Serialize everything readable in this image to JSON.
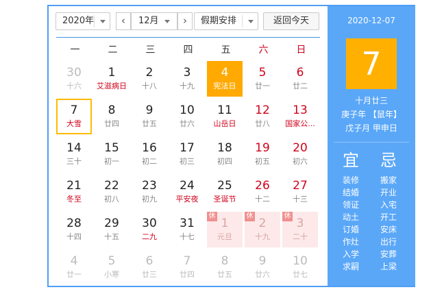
{
  "toolbar": {
    "year": "2020年",
    "month": "12月",
    "holiday": "假期安排",
    "today_button": "返回今天",
    "prev": "‹",
    "next": "›"
  },
  "weekdays": [
    "一",
    "二",
    "三",
    "四",
    "五",
    "六",
    "日"
  ],
  "colors": {
    "accent": "#4e9ef5",
    "selected": "#ffa901",
    "side": "#5aa7f8",
    "red": "#d0021b"
  },
  "weeks": [
    [
      {
        "d": "30",
        "l": "十六",
        "t": "other"
      },
      {
        "d": "1",
        "l": "艾滋病日",
        "fest": true
      },
      {
        "d": "2",
        "l": "十八"
      },
      {
        "d": "3",
        "l": "十九"
      },
      {
        "d": "4",
        "l": "宪法日",
        "t": "selected"
      },
      {
        "d": "5",
        "l": "廿一",
        "we": true
      },
      {
        "d": "6",
        "l": "廿二",
        "we": true
      }
    ],
    [
      {
        "d": "7",
        "l": "大雪",
        "t": "today",
        "fest": true
      },
      {
        "d": "8",
        "l": "廿四"
      },
      {
        "d": "9",
        "l": "廿五"
      },
      {
        "d": "10",
        "l": "廿六"
      },
      {
        "d": "11",
        "l": "山岳日",
        "fest": true
      },
      {
        "d": "12",
        "l": "廿八",
        "we": true
      },
      {
        "d": "13",
        "l": "国家公...",
        "we": true,
        "fest": true
      }
    ],
    [
      {
        "d": "14",
        "l": "三十"
      },
      {
        "d": "15",
        "l": "初一"
      },
      {
        "d": "16",
        "l": "初二"
      },
      {
        "d": "17",
        "l": "初三"
      },
      {
        "d": "18",
        "l": "初四"
      },
      {
        "d": "19",
        "l": "初五",
        "we": true
      },
      {
        "d": "20",
        "l": "初六",
        "we": true
      }
    ],
    [
      {
        "d": "21",
        "l": "冬至",
        "fest": true
      },
      {
        "d": "22",
        "l": "初八"
      },
      {
        "d": "23",
        "l": "初九"
      },
      {
        "d": "24",
        "l": "平安夜",
        "fest": true
      },
      {
        "d": "25",
        "l": "圣诞节",
        "fest": true
      },
      {
        "d": "26",
        "l": "十二",
        "we": true
      },
      {
        "d": "27",
        "l": "十三",
        "we": true
      }
    ],
    [
      {
        "d": "28",
        "l": "十四"
      },
      {
        "d": "29",
        "l": "十五"
      },
      {
        "d": "30",
        "l": "二九",
        "fest": true
      },
      {
        "d": "31",
        "l": "十七"
      },
      {
        "d": "1",
        "l": "元旦",
        "t": "holiday",
        "badge": "休"
      },
      {
        "d": "2",
        "l": "十九",
        "t": "holiday",
        "badge": "休"
      },
      {
        "d": "3",
        "l": "二十",
        "t": "holiday",
        "badge": "休"
      }
    ],
    [
      {
        "d": "4",
        "l": "廿一",
        "t": "other"
      },
      {
        "d": "5",
        "l": "小寒",
        "t": "other"
      },
      {
        "d": "6",
        "l": "廿三",
        "t": "other"
      },
      {
        "d": "7",
        "l": "廿四",
        "t": "other"
      },
      {
        "d": "8",
        "l": "廿五",
        "t": "other"
      },
      {
        "d": "9",
        "l": "廿六",
        "t": "other"
      },
      {
        "d": "10",
        "l": "廿七",
        "t": "other"
      }
    ]
  ],
  "side": {
    "date": "2020-12-07",
    "day": "7",
    "lunar": "十月廿三",
    "ganzhi_year": "庚子年 【鼠年】",
    "ganzhi_mday": "戊子月 甲申日",
    "yi_title": "宜",
    "ji_title": "忌",
    "yi": [
      "装修",
      "结婚",
      "领证",
      "动土",
      "订婚",
      "作灶",
      "入学",
      "求嗣"
    ],
    "ji": [
      "搬家",
      "开业",
      "入宅",
      "开工",
      "安床",
      "出行",
      "安葬",
      "上梁"
    ]
  }
}
